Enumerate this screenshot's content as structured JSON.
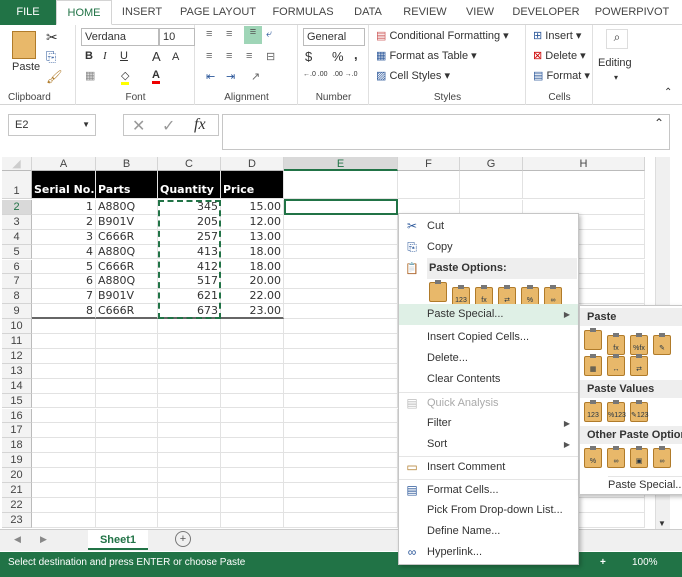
{
  "ribbon_tabs": [
    "FILE",
    "HOME",
    "INSERT",
    "PAGE LAYOUT",
    "FORMULAS",
    "DATA",
    "REVIEW",
    "VIEW",
    "DEVELOPER",
    "POWERPIVOT"
  ],
  "ribbon": {
    "clipboard": {
      "label": "Clipboard",
      "paste": "Paste"
    },
    "font": {
      "label": "Font",
      "name": "Verdana",
      "size": "10",
      "bold": "B",
      "italic": "I",
      "underline": "U",
      "grow": "A",
      "shrink": "A",
      "color_letter": "A"
    },
    "alignment": {
      "label": "Alignment"
    },
    "number": {
      "label": "Number",
      "format": "General",
      "currency": "$",
      "percent": "%",
      "comma": ",",
      "inc_decimal": "←.0 .00",
      "dec_decimal": ".00 →.0"
    },
    "styles": {
      "label": "Styles",
      "conditional": "Conditional Formatting",
      "format_table": "Format as Table",
      "cell_styles": "Cell Styles"
    },
    "cells": {
      "label": "Cells",
      "insert": "Insert",
      "delete": "Delete",
      "format": "Format"
    },
    "editing": {
      "label": "Editing"
    }
  },
  "formula_bar": {
    "name_box": "E2",
    "cancel": "✕",
    "enter": "✓",
    "fx": "fx",
    "value": ""
  },
  "columns": [
    "A",
    "B",
    "C",
    "D",
    "E",
    "F",
    "G",
    "H"
  ],
  "sheet": {
    "headers": [
      "Serial No.",
      "Parts",
      "Quantity",
      "Price"
    ],
    "rows": [
      [
        "1",
        "A880Q",
        "345",
        "15.00"
      ],
      [
        "2",
        "B901V",
        "205",
        "12.00"
      ],
      [
        "3",
        "C666R",
        "257",
        "13.00"
      ],
      [
        "4",
        "A880Q",
        "413",
        "18.00"
      ],
      [
        "5",
        "C666R",
        "412",
        "18.00"
      ],
      [
        "6",
        "A880Q",
        "517",
        "20.00"
      ],
      [
        "7",
        "B901V",
        "621",
        "22.00"
      ],
      [
        "8",
        "C666R",
        "673",
        "23.00"
      ]
    ],
    "row_count": 23,
    "active_cell": "E2",
    "copy_range": "C2:C9"
  },
  "sheet_tabs": {
    "active": "Sheet1",
    "add": "+"
  },
  "status": {
    "message": "Select destination and press ENTER or choose Paste",
    "zoom": "100%",
    "zoom_out": "−",
    "zoom_in": "+"
  },
  "context_menu": {
    "cut": "Cut",
    "copy": "Copy",
    "paste_options": "Paste Options:",
    "paste_icons": [
      "",
      "123",
      "fx",
      "⇄",
      "%",
      "∞"
    ],
    "paste_special": "Paste Special...",
    "insert_copied": "Insert Copied Cells...",
    "delete": "Delete...",
    "clear": "Clear Contents",
    "quick_analysis": "Quick Analysis",
    "filter": "Filter",
    "sort": "Sort",
    "insert_comment": "Insert Comment",
    "format_cells": "Format Cells...",
    "pick_list": "Pick From Drop-down List...",
    "define_name": "Define Name...",
    "hyperlink": "Hyperlink..."
  },
  "submenu": {
    "paste": "Paste",
    "paste_values": "Paste Values",
    "other": "Other Paste Options",
    "paste_special": "Paste Special...",
    "paste_icons_row1": [
      "",
      "fx",
      "%fx",
      "✎"
    ],
    "paste_icons_row2": [
      "▦",
      "↔",
      "⇄"
    ],
    "value_icons": [
      "123",
      "%123",
      "✎123"
    ],
    "other_icons": [
      "%",
      "∞",
      "▣",
      "∞"
    ]
  },
  "colors": {
    "accent": "#217346"
  }
}
